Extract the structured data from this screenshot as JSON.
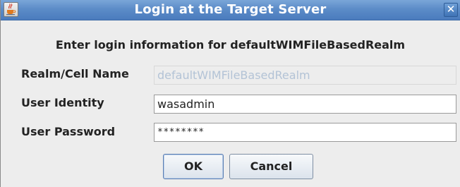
{
  "window": {
    "title": "Login at the Target Server",
    "close_label": "✕",
    "app_icon": "java-cup-icon"
  },
  "form": {
    "heading": "Enter login information for defaultWIMFileBasedRealm",
    "realm": {
      "label": "Realm/Cell Name",
      "value": "defaultWIMFileBasedRealm",
      "enabled": false
    },
    "user_identity": {
      "label": "User Identity",
      "value": "wasadmin"
    },
    "user_password": {
      "label": "User Password",
      "value": "********"
    }
  },
  "buttons": {
    "ok": "OK",
    "cancel": "Cancel"
  }
}
